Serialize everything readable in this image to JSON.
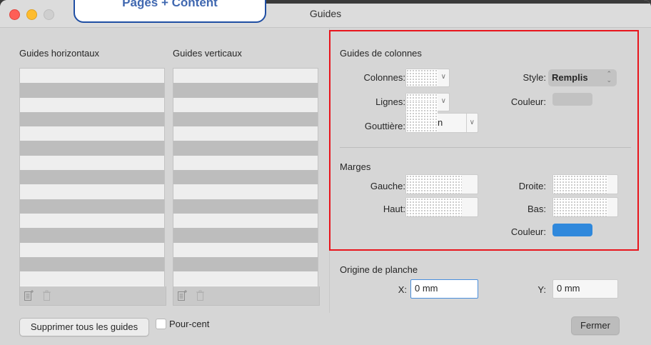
{
  "window": {
    "title": "Guides",
    "callout_text": "Pages + Content"
  },
  "left": {
    "horizontal_label": "Guides horizontaux",
    "vertical_label": "Guides verticaux",
    "delete_all_button": "Supprimer tous les guides",
    "percent_checkbox": "Pour-cent",
    "percent_checked": false
  },
  "columns": {
    "section_title": "Guides de colonnes",
    "columns_label": "Colonnes:",
    "rows_label": "Lignes:",
    "gutter_label": "Gouttière:",
    "gutter_unit_fragment": "n",
    "style_label": "Style:",
    "style_value": "Remplis",
    "color_label": "Couleur:",
    "color_value": "#c2c2c2"
  },
  "margins": {
    "section_title": "Marges",
    "left_label": "Gauche:",
    "right_label": "Droite:",
    "top_label": "Haut:",
    "bottom_label": "Bas:",
    "color_label": "Couleur:",
    "color_value": "#2f88dc"
  },
  "origin": {
    "section_title": "Origine de planche",
    "x_label": "X:",
    "x_value": "0 mm",
    "y_label": "Y:",
    "y_value": "0 mm"
  },
  "footer": {
    "close_button": "Fermer"
  },
  "icons": [
    "add-guide-icon",
    "trash-icon"
  ]
}
